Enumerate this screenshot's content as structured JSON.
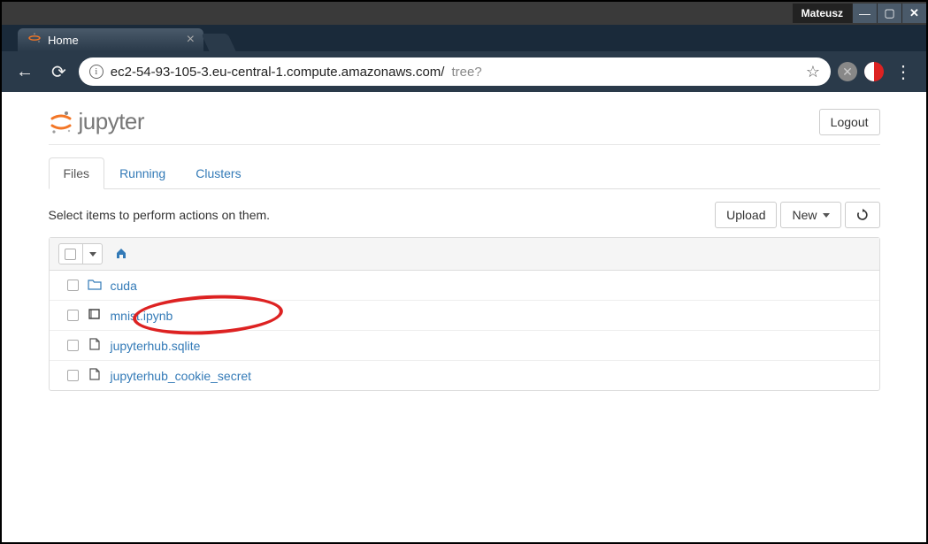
{
  "window": {
    "user": "Mateusz"
  },
  "browser": {
    "tab_title": "Home",
    "url_host": "ec2-54-93-105-3.eu-central-1.compute.amazonaws.com/",
    "url_path": "tree?"
  },
  "app": {
    "logo": "jupyter",
    "logout": "Logout",
    "tabs": {
      "files": "Files",
      "running": "Running",
      "clusters": "Clusters"
    },
    "hint": "Select items to perform actions on them.",
    "toolbar": {
      "upload": "Upload",
      "new": "New"
    },
    "files": {
      "0": {
        "name": "cuda",
        "type": "folder"
      },
      "1": {
        "name": "mnist.ipynb",
        "type": "notebook"
      },
      "2": {
        "name": "jupyterhub.sqlite",
        "type": "file"
      },
      "3": {
        "name": "jupyterhub_cookie_secret",
        "type": "file"
      }
    }
  }
}
